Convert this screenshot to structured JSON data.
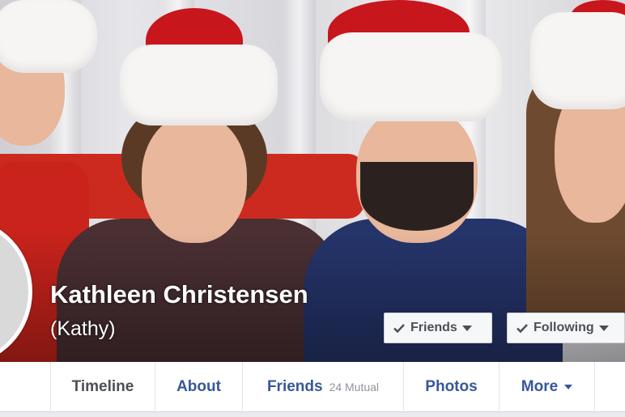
{
  "profile": {
    "name": "Kathleen Christensen",
    "alternate_name": "(Kathy)"
  },
  "cover_actions": {
    "friends_label": "Friends",
    "following_label": "Following"
  },
  "tabs": [
    {
      "label": "Timeline",
      "active": true
    },
    {
      "label": "About"
    },
    {
      "label": "Friends",
      "sub": "24 Mutual"
    },
    {
      "label": "Photos"
    },
    {
      "label": "More"
    }
  ],
  "icons": {
    "check": "check-icon",
    "caret": "caret-down-icon"
  },
  "colors": {
    "link_blue": "#365899",
    "active_tab": "#4b4f56",
    "hat_red": "#c8161d"
  }
}
